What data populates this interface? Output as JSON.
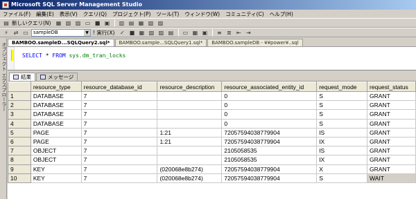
{
  "window": {
    "title": "Microsoft SQL Server Management Studio"
  },
  "menu": [
    "ファイル(F)",
    "編集(E)",
    "表示(V)",
    "クエリ(Q)",
    "プロジェクト(P)",
    "ツール(T)",
    "ウィンドウ(W)",
    "コミュニティ(C)",
    "ヘルプ(H)"
  ],
  "toolbar": {
    "new_query_label": "新しいクエリ(N)",
    "database": "sampleDB",
    "execute_label": "! 実行(X)"
  },
  "side_panel": {
    "label": "オブジェクト エクスプローラー"
  },
  "doc_tabs": [
    "BAMBOO.sampleD...SQLQuery2.sql*",
    "BAMBOO.sample...SQLQuery1.sql*",
    "BAMBOO.sampleDB - ¥¥power¥..sql"
  ],
  "editor": {
    "keyword_select": "SELECT",
    "star": "*",
    "keyword_from": "FROM",
    "object": "sys.dm_tran_locks"
  },
  "result_tabs": {
    "results": "結果",
    "messages": "メッセージ"
  },
  "grid": {
    "columns": [
      "resource_type",
      "resource_database_id",
      "resource_description",
      "resource_associated_entity_id",
      "request_mode",
      "request_status"
    ],
    "rows": [
      [
        "1",
        "DATABASE",
        "7",
        "",
        "0",
        "S",
        "GRANT"
      ],
      [
        "2",
        "DATABASE",
        "7",
        "",
        "0",
        "S",
        "GRANT"
      ],
      [
        "3",
        "DATABASE",
        "7",
        "",
        "0",
        "S",
        "GRANT"
      ],
      [
        "4",
        "DATABASE",
        "7",
        "",
        "0",
        "S",
        "GRANT"
      ],
      [
        "5",
        "PAGE",
        "7",
        "1:21",
        "72057594038779904",
        "IS",
        "GRANT"
      ],
      [
        "6",
        "PAGE",
        "7",
        "1:21",
        "72057594038779904",
        "IX",
        "GRANT"
      ],
      [
        "7",
        "OBJECT",
        "7",
        "",
        "2105058535",
        "IS",
        "GRANT"
      ],
      [
        "8",
        "OBJECT",
        "7",
        "",
        "2105058535",
        "IX",
        "GRANT"
      ],
      [
        "9",
        "KEY",
        "7",
        "(020068e8b274)",
        "72057594038779904",
        "X",
        "GRANT"
      ],
      [
        "10",
        "KEY",
        "7",
        "(020068e8b274)",
        "72057594038779904",
        "S",
        "WAIT"
      ]
    ]
  }
}
